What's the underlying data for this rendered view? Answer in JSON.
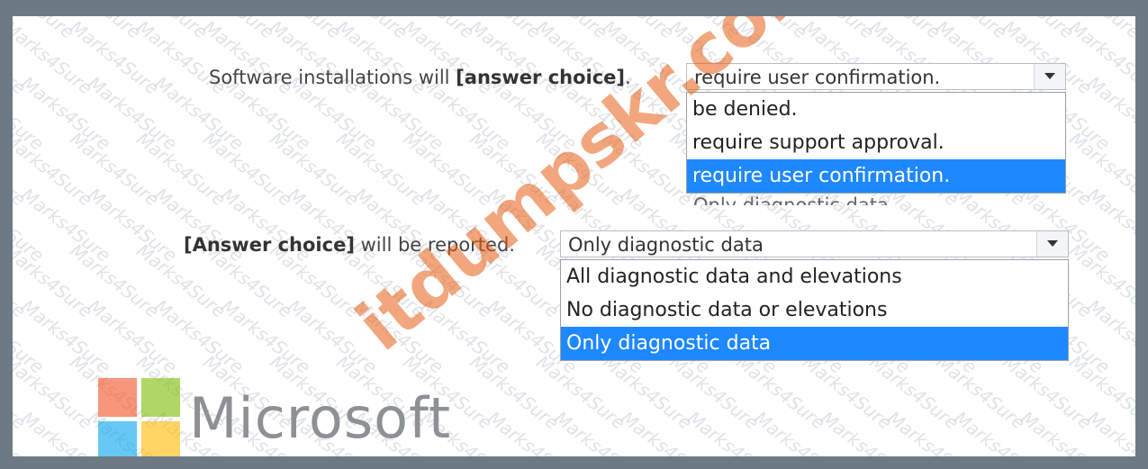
{
  "question1": {
    "label_prefix": "Software installations will ",
    "label_bold": "[answer choice]",
    "label_suffix": ".",
    "selected_value": "require user confirmation.",
    "options": [
      "be denied.",
      "require support approval.",
      "require user confirmation."
    ],
    "selected_index": 2
  },
  "question2": {
    "label_bold": "[Answer choice]",
    "label_suffix": " will be reported.",
    "selected_value": "Only diagnostic data",
    "options": [
      "All diagnostic data and elevations",
      "No diagnostic data or elevations",
      "Only diagnostic data"
    ],
    "selected_index": 2
  },
  "ghost_text": "Only diagnostic data",
  "logo": {
    "wordmark": "Microsoft",
    "colors": [
      "#f25022",
      "#7fba00",
      "#00a4ef",
      "#ffb900"
    ]
  },
  "watermarks": {
    "tile_text": "Marks4Sure",
    "url_text": "itdumpskr.com"
  },
  "colors": {
    "selection_blue": "#1e88ff",
    "frame": "#6d7a86"
  }
}
